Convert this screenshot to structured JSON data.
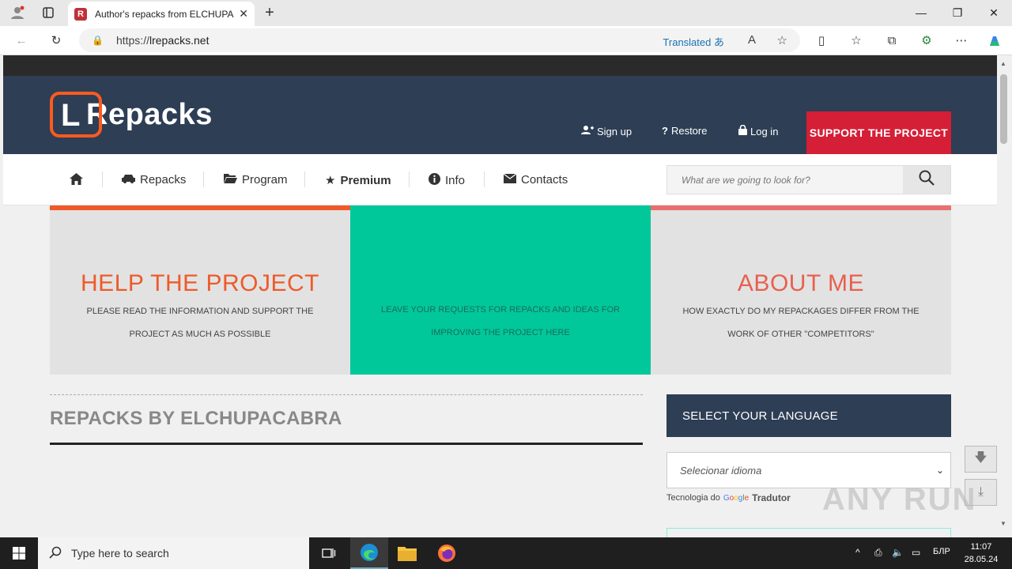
{
  "browser": {
    "tab_title": "Author's repacks from ELCHUPACABRA",
    "url_scheme": "https://",
    "url_host": "lrepacks.net",
    "translated_label": "Translated"
  },
  "header": {
    "logo_text": "Repacks",
    "logo_letter": "L",
    "signup_label": "Sign up",
    "restore_label": "Restore",
    "login_label": "Log in",
    "support_label": "SUPPORT THE PROJECT"
  },
  "nav": {
    "items": [
      "Repacks",
      "Program",
      "Premium",
      "Info",
      "Contacts"
    ],
    "search_placeholder": "What are we going to look for?"
  },
  "panels": [
    {
      "title": "HELP THE PROJECT",
      "text": "PLEASE READ THE INFORMATION AND SUPPORT THE PROJECT AS MUCH AS POSSIBLE"
    },
    {
      "title": "",
      "text": "LEAVE YOUR REQUESTS FOR REPACKS AND IDEAS FOR IMPROVING THE PROJECT HERE"
    },
    {
      "title": "ABOUT ME",
      "text": "HOW EXACTLY DO MY REPACKAGES DIFFER FROM THE WORK OF OTHER \"COMPETITORS\""
    }
  ],
  "main": {
    "section_title": "REPACKS BY ELCHUPACABRA"
  },
  "sidebar": {
    "language_heading": "SELECT YOUR LANGUAGE",
    "language_select_value": "Selecionar idioma",
    "powered_prefix": "Tecnologia do",
    "powered_brand": "Tradutor"
  },
  "watermark": "ANY RUN",
  "taskbar": {
    "search_placeholder": "Type here to search",
    "language": "БЛР",
    "time": "11:07",
    "date": "28.05.24"
  },
  "colors": {
    "header_bg": "#2d3e55",
    "support_red": "#d51f36",
    "accent_orange": "#f05a28",
    "accent_green": "#00c89b",
    "accent_pink": "#ea7070"
  }
}
